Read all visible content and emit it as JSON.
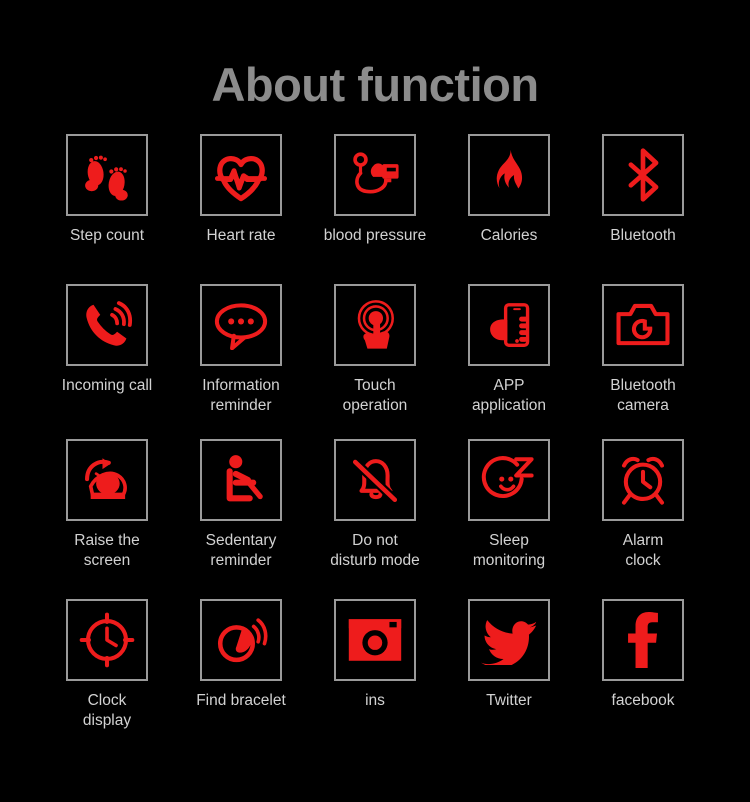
{
  "page": {
    "title": "About function",
    "background_color": "#000000",
    "title_color": "#8c8c8c",
    "icon_color": "#ee1c1c",
    "icon_border_color": "#9a9a9a",
    "label_color": "#d2d2d2"
  },
  "features": [
    {
      "icon": "footprints-icon",
      "label": "Step count"
    },
    {
      "icon": "heart-pulse-icon",
      "label": "Heart rate"
    },
    {
      "icon": "blood-pressure-icon",
      "label": "blood pressure"
    },
    {
      "icon": "flame-icon",
      "label": "Calories"
    },
    {
      "icon": "bluetooth-icon",
      "label": "Bluetooth"
    },
    {
      "icon": "incoming-call-icon",
      "label": "Incoming call"
    },
    {
      "icon": "message-bubble-icon",
      "label": "Information\nreminder"
    },
    {
      "icon": "touch-hand-icon",
      "label": "Touch\noperation"
    },
    {
      "icon": "phone-app-hand-icon",
      "label": "APP\napplication"
    },
    {
      "icon": "camera-icon",
      "label": "Bluetooth\ncamera"
    },
    {
      "icon": "raise-wrist-icon",
      "label": "Raise the\nscreen"
    },
    {
      "icon": "sitting-person-icon",
      "label": "Sedentary\nreminder"
    },
    {
      "icon": "bell-muted-icon",
      "label": "Do not\ndisturb mode"
    },
    {
      "icon": "sleep-face-icon",
      "label": "Sleep\nmonitoring"
    },
    {
      "icon": "alarm-clock-icon",
      "label": "Alarm\nclock"
    },
    {
      "icon": "watch-clock-icon",
      "label": "Clock\ndisplay"
    },
    {
      "icon": "find-bracelet-icon",
      "label": "Find bracelet"
    },
    {
      "icon": "instagram-icon",
      "label": "ins"
    },
    {
      "icon": "twitter-bird-icon",
      "label": "Twitter"
    },
    {
      "icon": "facebook-icon",
      "label": "facebook"
    }
  ]
}
